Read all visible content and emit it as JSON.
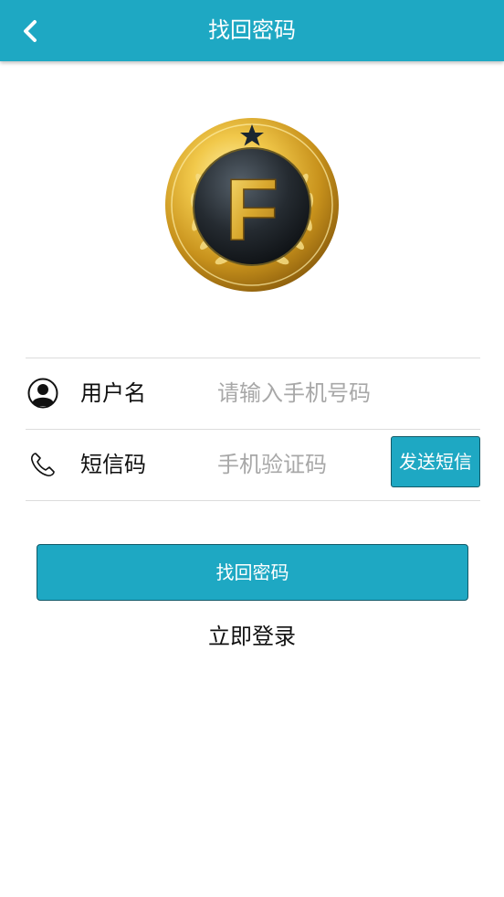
{
  "header": {
    "title": "找回密码",
    "back_icon": "chevron-left-icon"
  },
  "logo": {
    "letter": "F"
  },
  "form": {
    "username": {
      "icon": "user-icon",
      "label": "用户名",
      "placeholder": "请输入手机号码",
      "value": ""
    },
    "sms_code": {
      "icon": "phone-icon",
      "label": "短信码",
      "placeholder": "手机验证码",
      "value": "",
      "send_button": "发送短信"
    }
  },
  "actions": {
    "submit_label": "找回密码",
    "login_link": "立即登录"
  },
  "colors": {
    "accent": "#1ea8c3",
    "button_border": "#135a68",
    "gold": "#d4a72c"
  }
}
